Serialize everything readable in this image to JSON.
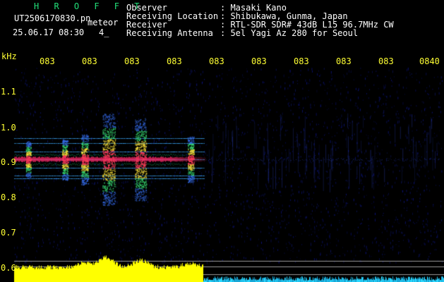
{
  "app": {
    "name": "H R O F F T",
    "file": "UT2506170830.pn",
    "mode": "meteor",
    "datetime": "25.06.17 08:30",
    "count": "4_"
  },
  "info": {
    "observer_label": "Observer",
    "observer_value": ": Masaki Kano",
    "location_label": "Receiving Location",
    "location_value": ": Shibukawa, Gunma, Japan",
    "receiver_label": "Receiver",
    "receiver_value": ": RTL-SDR SDR# 43dB L15 96.7MHz CW",
    "antenna_label": "Receiving Antenna",
    "antenna_value": ": 5el Yagi Az 280 for Seoul"
  },
  "axis": {
    "unit": "kHz",
    "y_ticks": [
      "1.1",
      "1.0",
      "0.9",
      "0.8",
      "0.7",
      "0.6"
    ],
    "x_ticks": [
      "083",
      "083",
      "083",
      "083",
      "083",
      "083",
      "083",
      "083",
      "083",
      "0840"
    ]
  },
  "colors": {
    "background": "#000000",
    "header_text": "#ffffff",
    "axis_text": "#ffff33",
    "title": "#22e07a",
    "signal_core": "#ff2a6a",
    "level_bar": "#ffff00",
    "level_low": "#2bd8ff"
  }
}
